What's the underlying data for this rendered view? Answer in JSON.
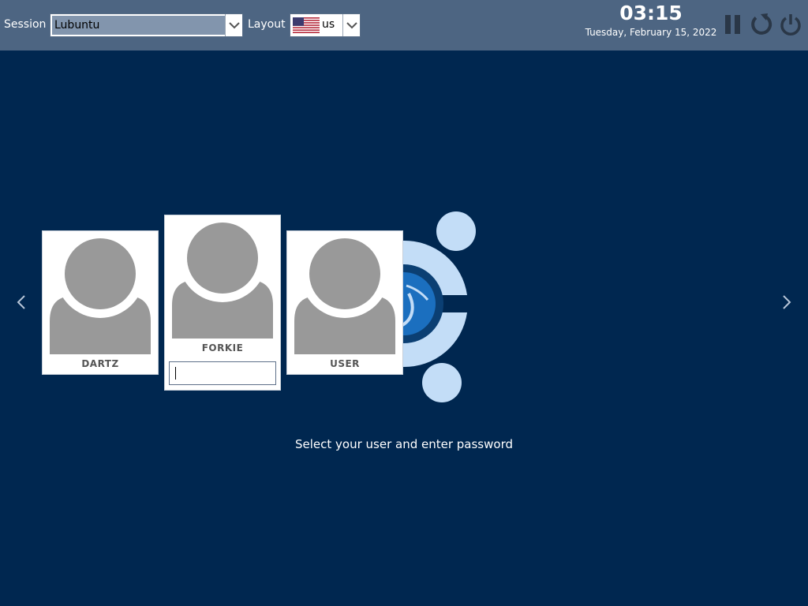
{
  "topbar": {
    "session_label": "Session",
    "session_value": "Lubuntu",
    "layout_label": "Layout",
    "layout_value": "us",
    "time": "03:15",
    "date": "Tuesday, February 15, 2022"
  },
  "users": [
    {
      "name": "DARTZ"
    },
    {
      "name": "FORKIE"
    },
    {
      "name": "USER"
    }
  ],
  "password": {
    "value": ""
  },
  "hint": "Select your user and enter password",
  "colors": {
    "background": "#002750",
    "topbar": "#4d6582",
    "avatar": "#999999",
    "logo_light": "#c3ddf7",
    "logo_dark": "#0b3f73",
    "logo_mid": "#1b6fbf"
  },
  "icons": [
    "chevron-down-icon",
    "us-flag-icon",
    "suspend-icon",
    "restart-icon",
    "power-icon",
    "chevron-left-icon",
    "chevron-right-icon"
  ]
}
